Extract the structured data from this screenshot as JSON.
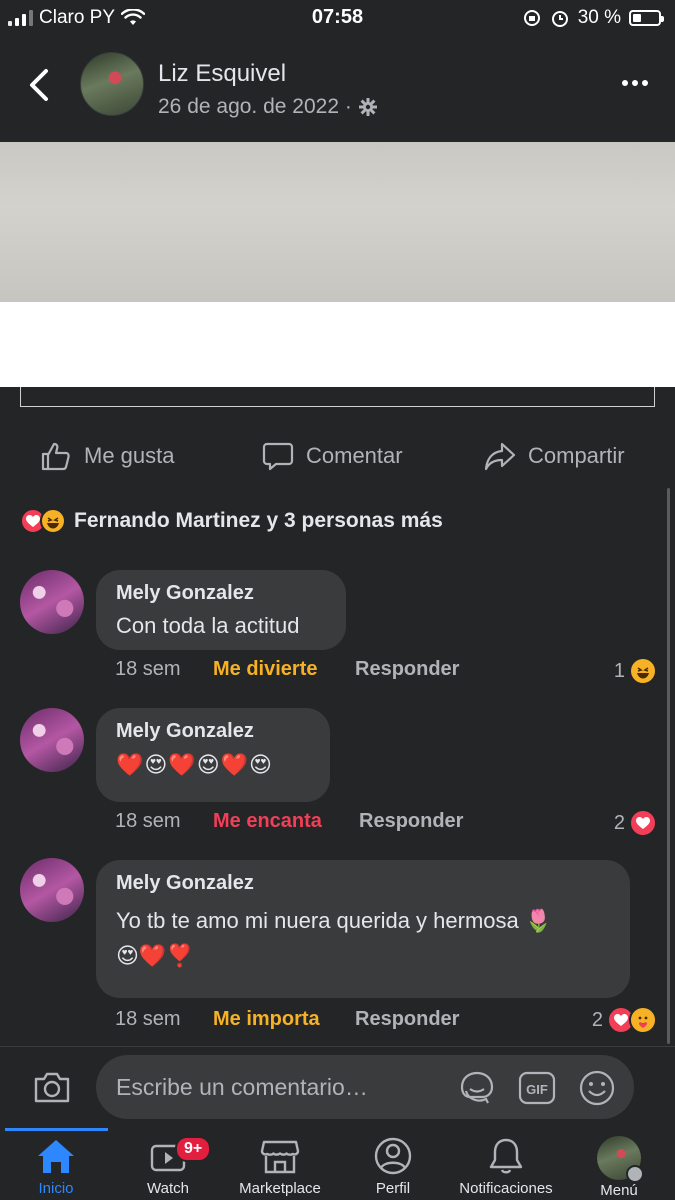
{
  "status_bar": {
    "carrier": "Claro PY",
    "time": "07:58",
    "battery": "30 %"
  },
  "post": {
    "author": "Liz Esquivel",
    "date": "26 de ago. de 2022 ·"
  },
  "actions": {
    "like": "Me gusta",
    "comment": "Comentar",
    "share": "Compartir"
  },
  "reactions_summary": {
    "text": "Fernando Martinez y 3 personas más",
    "icons": [
      "heart-icon",
      "haha-icon"
    ]
  },
  "comments": [
    {
      "author": "Mely Gonzalez",
      "text": "Con toda la actitud",
      "time": "18 sem",
      "reaction_label": "Me divierte",
      "reaction_color": "#f7b125",
      "reply": "Responder",
      "count": "1"
    },
    {
      "author": "Mely Gonzalez",
      "text": "❤️😍❤️😍❤️😍",
      "time": "18 sem",
      "reaction_label": "Me encanta",
      "reaction_color": "#f33e58",
      "reply": "Responder",
      "count": "2"
    },
    {
      "author": "Mely Gonzalez",
      "text": "Yo tb te amo mi nuera querida y hermosa 🌷",
      "text2": "😍❤️❣️",
      "time": "18 sem",
      "reaction_label": "Me importa",
      "reaction_color": "#f7b125",
      "reply": "Responder",
      "count": "2"
    }
  ],
  "composer": {
    "placeholder": "Escribe un comentario…"
  },
  "nav": {
    "home": "Inicio",
    "watch": "Watch",
    "watch_badge": "9+",
    "marketplace": "Marketplace",
    "profile": "Perfil",
    "notifications": "Notificaciones",
    "menu": "Menú"
  }
}
